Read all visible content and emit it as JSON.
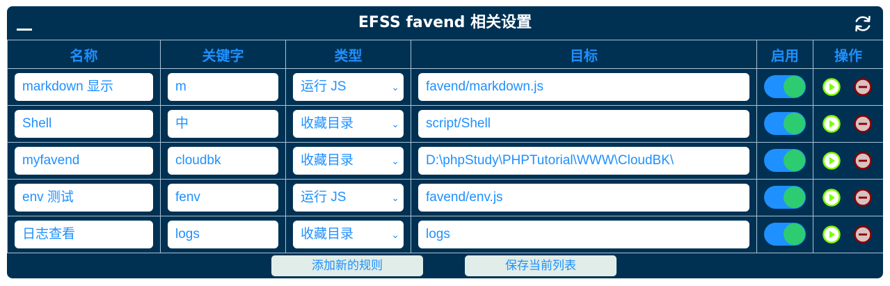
{
  "header": {
    "title": "EFSS favend 相关设置"
  },
  "columns": {
    "name": "名称",
    "keyword": "关键字",
    "type": "类型",
    "target": "目标",
    "enabled": "启用",
    "actions": "操作"
  },
  "rows": [
    {
      "name": "markdown 显示",
      "keyword": "m",
      "type": "运行 JS",
      "target": "favend/markdown.js",
      "enabled": true
    },
    {
      "name": "Shell",
      "keyword": "中",
      "type": "收藏目录",
      "target": "script/Shell",
      "enabled": true
    },
    {
      "name": "myfavend",
      "keyword": "cloudbk",
      "type": "收藏目录",
      "target": "D:\\phpStudy\\PHPTutorial\\WWW\\CloudBK\\",
      "enabled": true
    },
    {
      "name": "env 测试",
      "keyword": "fenv",
      "type": "运行 JS",
      "target": "favend/env.js",
      "enabled": true
    },
    {
      "name": "日志查看",
      "keyword": "logs",
      "type": "收藏目录",
      "target": "logs",
      "enabled": true
    }
  ],
  "footer": {
    "add_label": "添加新的规则",
    "save_label": "保存当前列表"
  },
  "colors": {
    "panel_bg": "#003153",
    "accent": "#1e90ff",
    "toggle_on": "#2ecc71",
    "play": "#7cfc00",
    "remove": "#8b0000"
  },
  "icons": {
    "minimize": "minimize-icon",
    "refresh": "refresh-icon",
    "run": "play-icon",
    "delete": "remove-icon",
    "dropdown": "chevron-down-icon"
  }
}
